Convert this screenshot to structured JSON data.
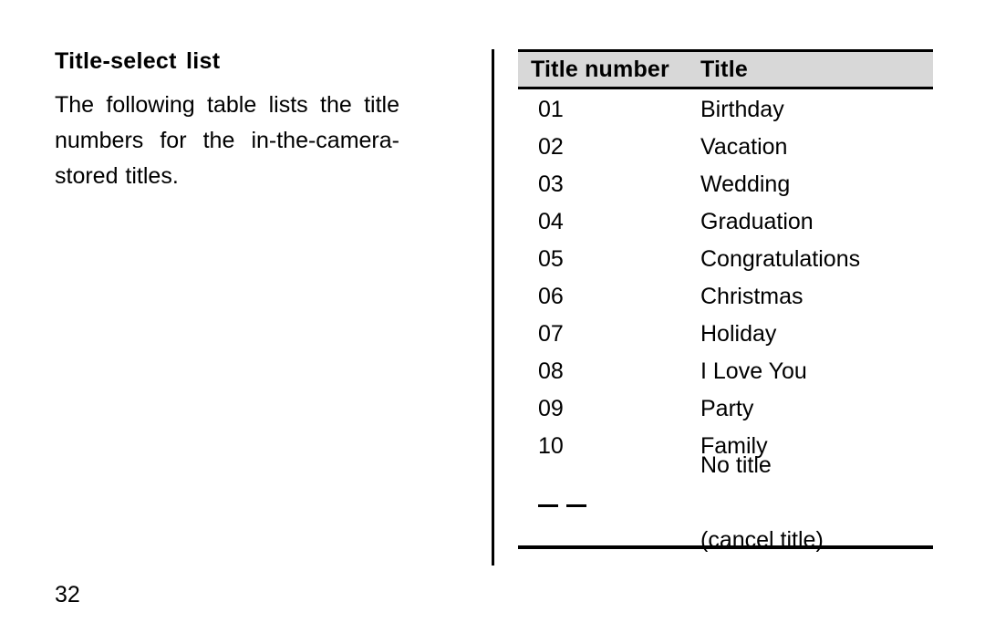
{
  "page": {
    "number": "32"
  },
  "left": {
    "heading": "Title-select list",
    "body": "The following table lists the title numbers for the in-the-camera-stored titles."
  },
  "table": {
    "columns": {
      "number": "Title number",
      "title": "Title"
    },
    "rows": [
      {
        "number": "01",
        "title": "Birthday"
      },
      {
        "number": "02",
        "title": "Vacation"
      },
      {
        "number": "03",
        "title": "Wedding"
      },
      {
        "number": "04",
        "title": "Graduation"
      },
      {
        "number": "05",
        "title": "Congratulations"
      },
      {
        "number": "06",
        "title": "Christmas"
      },
      {
        "number": "07",
        "title": "Holiday"
      },
      {
        "number": "08",
        "title": "I Love You"
      },
      {
        "number": "09",
        "title": "Party"
      },
      {
        "number": "10",
        "title": "Family"
      }
    ],
    "last_row": {
      "number": "_ _",
      "title_line1": "No title",
      "title_line2": "(cancel title)"
    }
  },
  "colors": {
    "header_band": "#d8d8d8",
    "rule": "#000000",
    "text": "#000000",
    "background": "#ffffff"
  }
}
